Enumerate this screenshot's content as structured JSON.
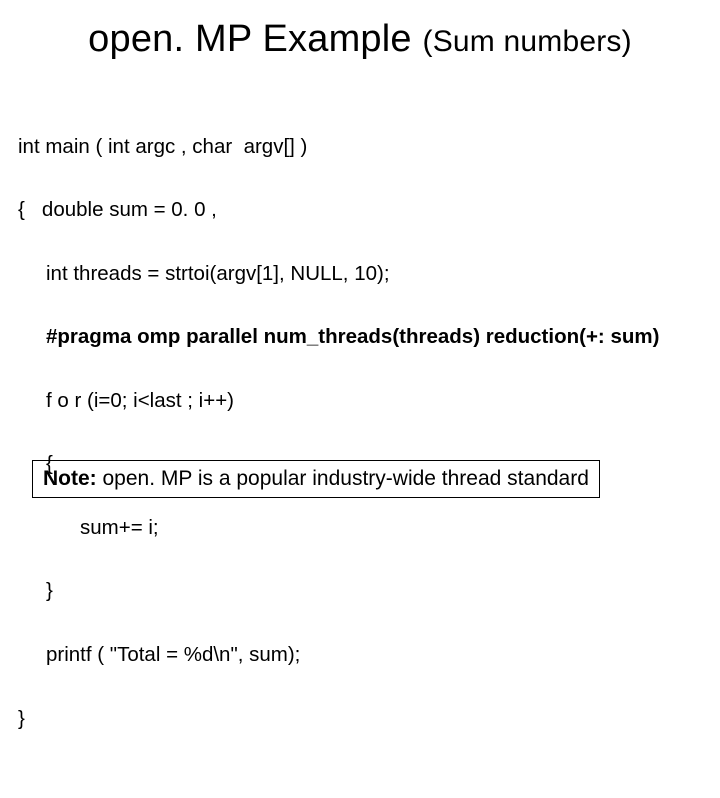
{
  "title": {
    "main": "open. MP Example ",
    "paren": "(Sum numbers)"
  },
  "code": {
    "l1": "int main ( int argc , char  argv[] )",
    "l2": "{   double sum = 0. 0 ,",
    "l3": "int threads = strtoi(argv[1], NULL, 10);",
    "l4": "#pragma omp parallel num_threads(threads) reduction(+: sum)",
    "l5": "f o r (i=0; i<last ; i++)",
    "l6": "{",
    "l7": "sum+= i;",
    "l8": "}",
    "l9": "printf ( \"Total = %d\\n\", sum);",
    "l10": "}"
  },
  "note": {
    "label": "Note:",
    "text": " open. MP is a popular industry-wide thread standard"
  }
}
